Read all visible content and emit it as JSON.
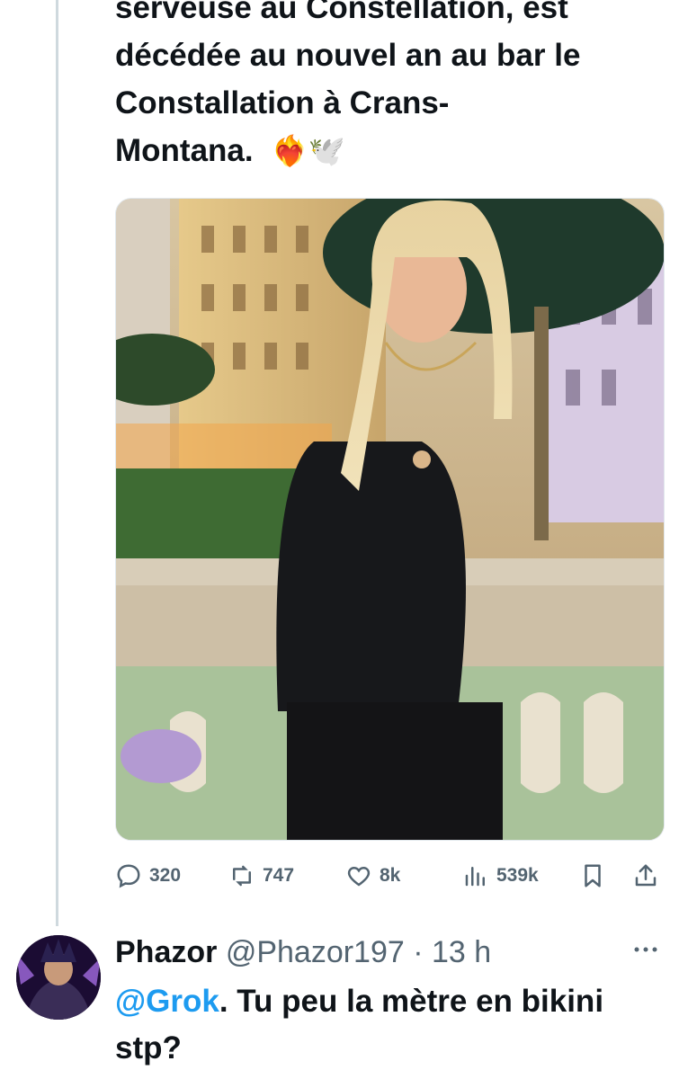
{
  "tweet": {
    "text": "serveuse au Constellation, est\ndécédée au nouvel an au bar le\nConstallation à Crans-\nMontana.",
    "emojis": "❤️‍🔥🕊️",
    "image_alt": "photo",
    "metrics": {
      "replies": "320",
      "reposts": "747",
      "likes": "8k",
      "views": "539k"
    }
  },
  "reply": {
    "name": "Phazor",
    "handle": "@Phazor197",
    "separator": " · ",
    "time": "13 h",
    "mention": "@Grok",
    "text": ". Tu peu la mètre en bikini stp?"
  },
  "icons": [
    "reply-icon",
    "repost-icon",
    "like-icon",
    "views-icon",
    "bookmark-icon",
    "share-icon",
    "more-icon"
  ],
  "colors": {
    "accent": "#1d9bf0",
    "muted": "#536471",
    "text": "#0f1419"
  }
}
